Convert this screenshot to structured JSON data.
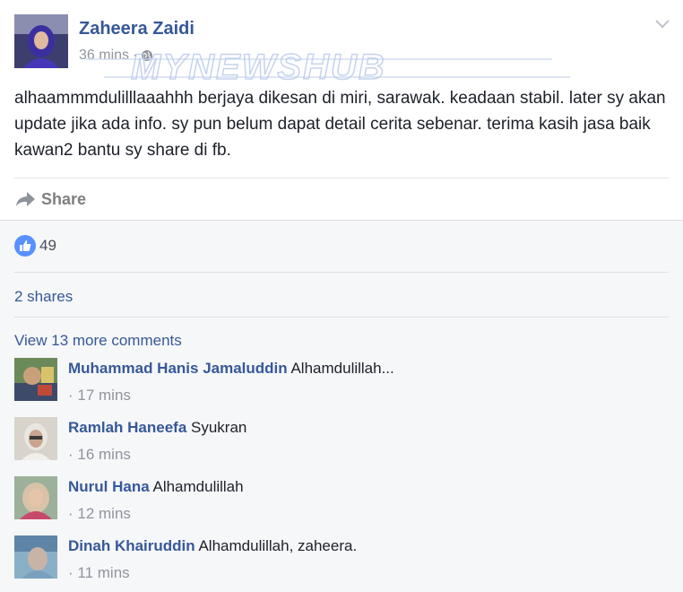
{
  "post": {
    "author": "Zaheera Zaidi",
    "time": "36 mins",
    "separator": "·",
    "privacy_icon": "globe-icon",
    "watermark": "MYNEWSHUB",
    "text": "alhaammmdulilllaaahhh berjaya dikesan di miri, sarawak. keadaan stabil. later sy akan update jika ada info. sy pun belum dapat detail cerita sebenar. terima kasih jasa baik kawan2 bantu sy share di fb.",
    "share_label": "Share",
    "share_icon": "share-arrow-icon",
    "menu_icon": "chevron-down-icon"
  },
  "feedback": {
    "like_icon": "thumbs-up-icon",
    "like_count": "49",
    "shares": "2 shares",
    "view_more": "View 13 more comments"
  },
  "comments": [
    {
      "name": "Muhammad Hanis Jamaluddin",
      "text": "Alhamdulillah...",
      "time": "· 17 mins"
    },
    {
      "name": "Ramlah Haneefa",
      "text": "Syukran",
      "time": "· 16 mins"
    },
    {
      "name": "Nurul Hana",
      "text": "Alhamdulillah",
      "time": "· 12 mins"
    },
    {
      "name": "Dinah Khairuddin",
      "text": "Alhamdulillah, zaheera.",
      "time": "· 11 mins"
    }
  ],
  "colors": {
    "link": "#365899",
    "text": "#1d2129",
    "muted": "#90949c",
    "like_blue": "#5890ff",
    "feedback_bg": "#f6f7f9"
  }
}
